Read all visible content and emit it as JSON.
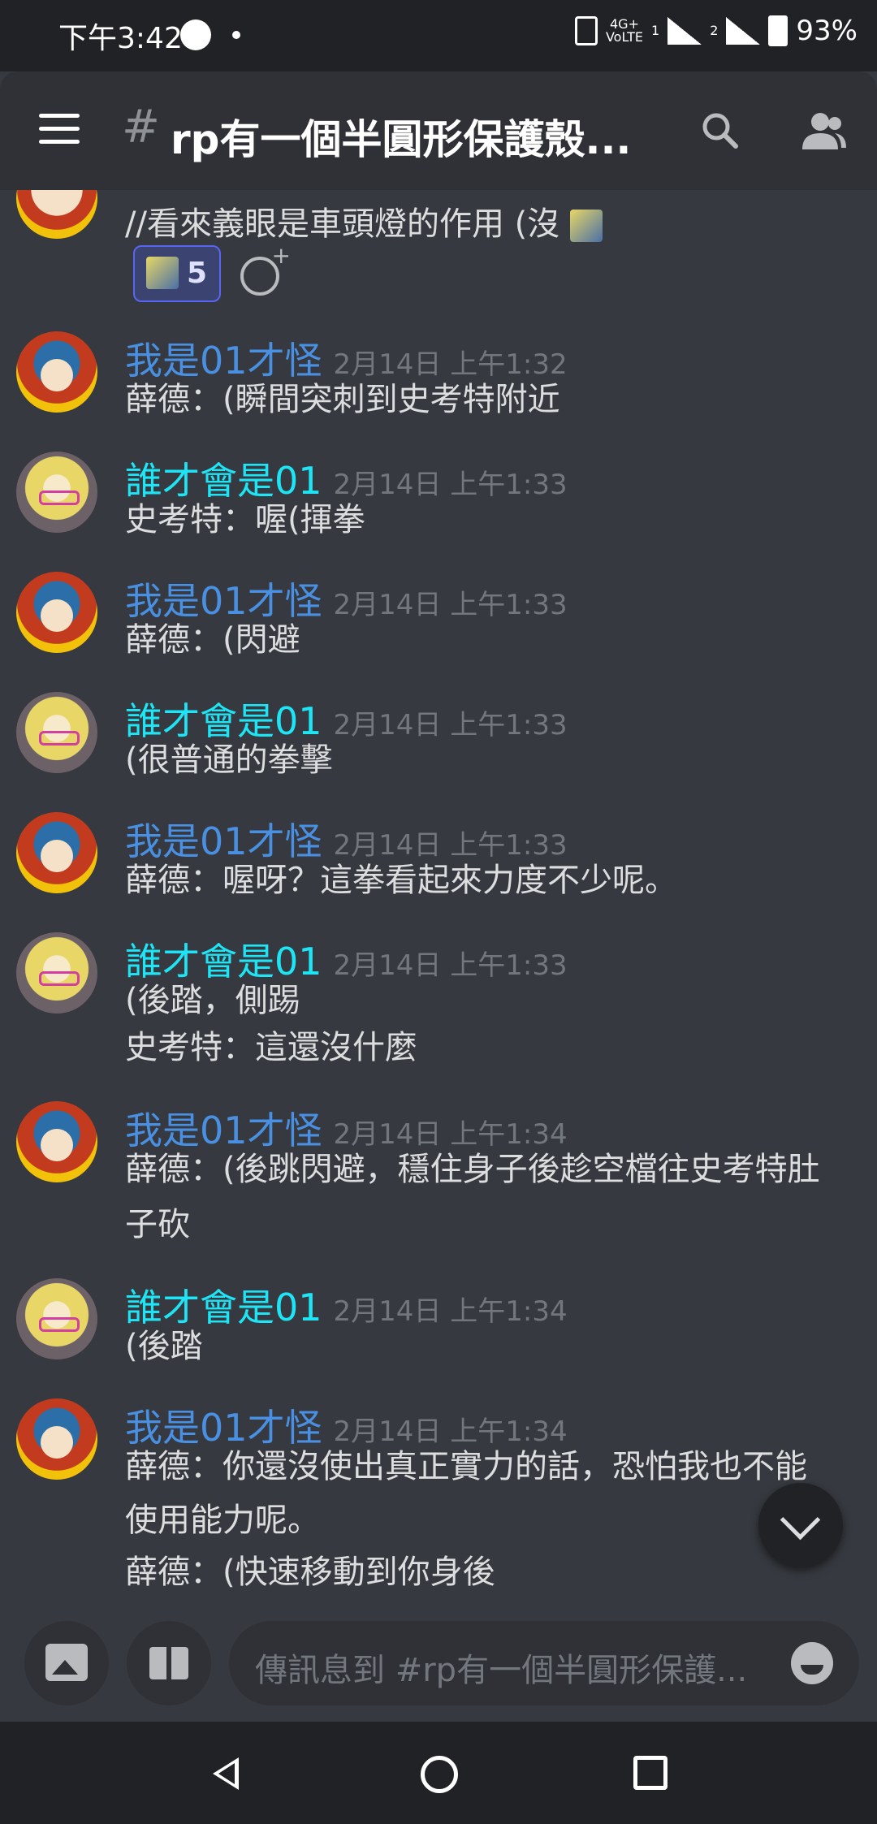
{
  "status_bar": {
    "time": "下午3:42",
    "network": "4G+",
    "volte": "VoLTE",
    "sim1": "1",
    "sim2": "2",
    "battery": "93%"
  },
  "header": {
    "hash": "#",
    "channel_title": "rp有一個半圓形保護殼..."
  },
  "top_partial_message": {
    "text": "//看來義眼是車頭燈的作用 (沒",
    "reaction_count": "5"
  },
  "messages": [
    {
      "author": "我是01才怪",
      "timestamp": "2月14日 上午1:32",
      "lines": [
        "薛德：(瞬間突刺到史考特附近"
      ]
    },
    {
      "author": "誰才會是01",
      "timestamp": "2月14日 上午1:33",
      "lines": [
        "史考特：喔(揮拳"
      ]
    },
    {
      "author": "我是01才怪",
      "timestamp": "2月14日 上午1:33",
      "lines": [
        "薛德：(閃避"
      ]
    },
    {
      "author": "誰才會是01",
      "timestamp": "2月14日 上午1:33",
      "lines": [
        "(很普通的拳擊"
      ]
    },
    {
      "author": "我是01才怪",
      "timestamp": "2月14日 上午1:33",
      "lines": [
        "薛德：喔呀？這拳看起來力度不少呢。"
      ]
    },
    {
      "author": "誰才會是01",
      "timestamp": "2月14日 上午1:33",
      "lines": [
        "(後踏，側踢",
        "史考特：這還沒什麼"
      ]
    },
    {
      "author": "我是01才怪",
      "timestamp": "2月14日 上午1:34",
      "lines": [
        "薛德：(後跳閃避，穩住身子後趁空檔往史考特肚",
        "子砍"
      ]
    },
    {
      "author": "誰才會是01",
      "timestamp": "2月14日 上午1:34",
      "lines": [
        "(後踏"
      ]
    },
    {
      "author": "我是01才怪",
      "timestamp": "2月14日 上午1:34",
      "lines": [
        "薛德：你還沒使出真正實力的話，恐怕我也不能",
        "使用能力呢。",
        "薛德：(快速移動到你身後"
      ]
    }
  ],
  "composer": {
    "placeholder": "傳訊息到 #rp有一個半圓形保護..."
  }
}
